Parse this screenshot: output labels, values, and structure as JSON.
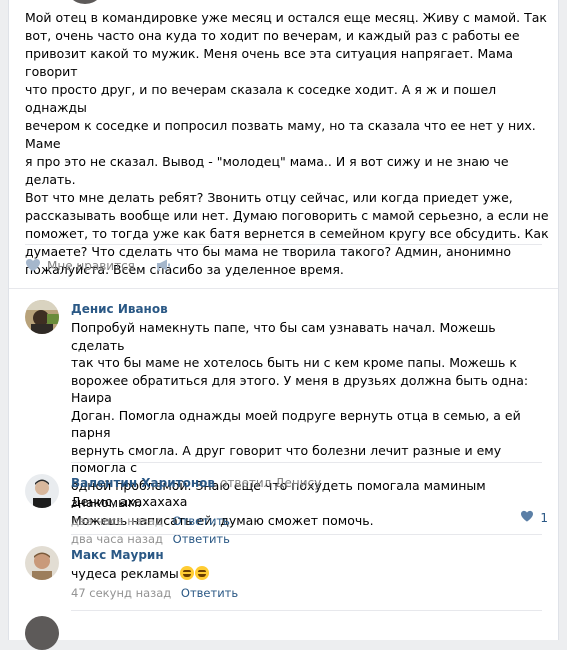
{
  "post": {
    "text": "Мой отец в командировке уже месяц и остался еще месяц. Живу с мамой. Так\nвот, очень часто она куда то ходит по вечерам, и каждый раз с работы ее\nпривозит какой то мужик. Меня очень все эта ситуация напрягает. Мама говорит\nчто просто друг, и по вечерам сказала к соседке ходит. А я ж и пошел однажды\nвечером к соседке и попросил позвать маму, но та сказала что ее нет у них. Маме\nя про это не сказал. Вывод - \"молодец\" мама.. И я вот сижу и не знаю че делать.\nВот что мне делать ребят? Звонить отцу сейчас, или когда приедет уже,\nрассказывать вообще или нет. Думаю поговорить с мамой серьезно, а если не\nпоможет, то тогда уже как батя вернется в семейном кругу все обсудить. Как\nдумаете? Что сделать что бы мама не творила такого? Админ, анонимно\nпожалуйста. Всем спасибо за уделенное время.",
    "like_label": "Мне нравится"
  },
  "comments": [
    {
      "author": "Денис Иванов",
      "reply_to": "",
      "text": "Попробуй намекнуть папе, что бы сам узнавать начал. Можешь сделать\nтак что бы маме не хотелось быть ни с кем кроме папы. Можешь к\nворожее обратиться для этого. У меня в друзьях должна быть одна: Наира\nДоган. Помогла однажды моей подруге вернуть отца в семью, а ей парня\nвернуть смогла. А друг говорит что болезни лечит разные и ему помогла с\nодной проблемой. Знаю еще что похудеть помогала маминым знакомым.\nМожешь написать ей, думаю сможет помочь.",
      "time": "два часа назад",
      "reply_label": "Ответить",
      "likes": ""
    },
    {
      "author": "Валентин Харитонов",
      "reply_to": "ответил Денису",
      "text": "Денис, ахахахаха",
      "time": "два часа назад",
      "reply_label": "Ответить",
      "likes": "1"
    },
    {
      "author": "Макс Маурин",
      "reply_to": "",
      "text": "чудеса рекламы",
      "time": "47 секунд назад",
      "reply_label": "Ответить",
      "likes": ""
    }
  ],
  "colors": {
    "link": "#2a5885",
    "meta": "#939393",
    "icon": "#a5b7cc"
  },
  "icons": [
    "heart-icon",
    "megaphone-icon",
    "grinning-emoji-icon"
  ]
}
